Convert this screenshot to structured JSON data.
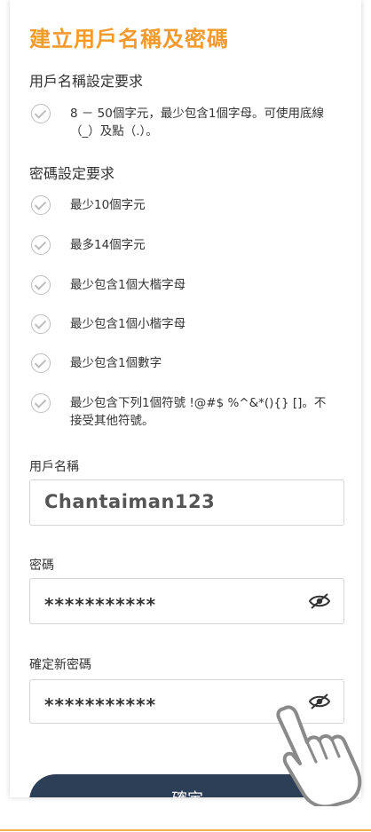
{
  "title": "建立用戶名稱及密碼",
  "username_requirements": {
    "heading": "用戶名稱設定要求",
    "items": [
      "8 － 50個字元，最少包含1個字母。可使用底線（_）及點（.）。"
    ]
  },
  "password_requirements": {
    "heading": "密碼設定要求",
    "items": [
      "最少10個字元",
      "最多14個字元",
      "最少包含1個大楷字母",
      "最少包含1個小楷字母",
      "最少包含1個數字",
      "最少包含下列1個符號 !@#$ %^&*(){} []。不接受其他符號。"
    ]
  },
  "fields": {
    "username": {
      "label": "用戶名稱",
      "value": "Chantaiman123"
    },
    "password": {
      "label": "密碼",
      "value": "***********"
    },
    "confirm_password": {
      "label": "確定新密碼",
      "value": "***********"
    }
  },
  "confirm_button": "確定",
  "colors": {
    "title": "#f29a2e",
    "button": "#2d3e57",
    "check": "#bdbdbd"
  }
}
